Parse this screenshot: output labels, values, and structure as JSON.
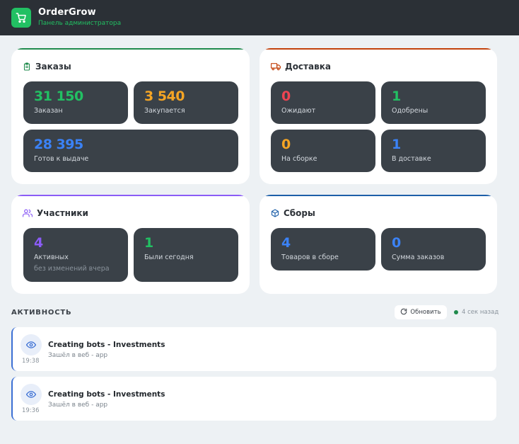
{
  "header": {
    "brand": "OrderGrow",
    "subtitle": "Панель администратора"
  },
  "colors": {
    "green": "#22c063",
    "orange": "#f5a524",
    "blue": "#3b82f6",
    "red": "#ef4452",
    "purple": "#8b5cf6",
    "tile_bg": "#3a4148"
  },
  "orders": {
    "title": "Заказы",
    "tiles": [
      {
        "value": "31 150",
        "label": "Заказан"
      },
      {
        "value": "3 540",
        "label": "Закупается"
      },
      {
        "value": "28 395",
        "label": "Готов к выдаче"
      }
    ]
  },
  "delivery": {
    "title": "Доставка",
    "tiles": [
      {
        "value": "0",
        "label": "Ожидают"
      },
      {
        "value": "1",
        "label": "Одобрены"
      },
      {
        "value": "0",
        "label": "На сборке"
      },
      {
        "value": "1",
        "label": "В доставке"
      }
    ]
  },
  "participants": {
    "title": "Участники",
    "tiles": [
      {
        "value": "4",
        "label": "Активных",
        "sub": "без изменений вчера"
      },
      {
        "value": "1",
        "label": "Были сегодня"
      }
    ]
  },
  "collections": {
    "title": "Сборы",
    "tiles": [
      {
        "value": "4",
        "label": "Товаров в сборе"
      },
      {
        "value": "0",
        "label": "Сумма заказов"
      }
    ]
  },
  "activity": {
    "title": "АКТИВНОСТЬ",
    "refresh_label": "Обновить",
    "status": "4 сек назад",
    "items": [
      {
        "name": "Creating bots - Investments",
        "desc": "Зашёл в веб - app",
        "time": "19:38",
        "icon": "eye-icon"
      },
      {
        "name": "Creating bots - Investments",
        "desc": "Зашёл в веб - app",
        "time": "19:36",
        "icon": "eye-icon"
      }
    ]
  }
}
